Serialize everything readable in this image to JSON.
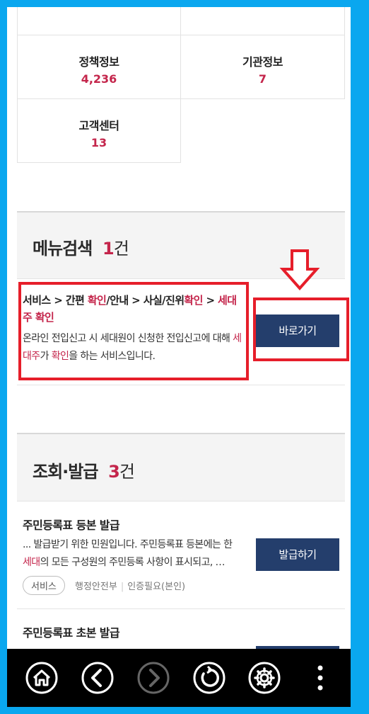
{
  "stats": {
    "policy": {
      "label": "정책정보",
      "count": "4,236"
    },
    "agency": {
      "label": "기관정보",
      "count": "7"
    },
    "center": {
      "label": "고객센터",
      "count": "13"
    }
  },
  "menu_search": {
    "title": "메뉴검색",
    "count": "1",
    "unit": "건",
    "result": {
      "path_parts": [
        "서비스 > 간편 ",
        "확인",
        "/안내 > 사실/진위",
        "확인",
        " > ",
        "세대주 확인"
      ],
      "desc_parts": [
        "온라인 전입신고 시 세대원이 신청한 전입신고에 대해 ",
        "세대주",
        "가 ",
        "확인",
        "을 하는 서비스입니다."
      ],
      "button": "바로가기"
    }
  },
  "inquiry": {
    "title": "조회·발급",
    "count": "3",
    "unit": "건",
    "items": [
      {
        "title": "주민등록표 등본 발급",
        "desc_line1": "... 발급받기 위한 민원입니다. 주민등록표 등본에는 한",
        "desc_line2_hl": "세대",
        "desc_line2_rest": "의 모든 구성원의 주민등록 사항이 표시되고, …",
        "tag": "서비스",
        "agency": "행정안전부",
        "auth": "인증필요(본인)",
        "button": "발급하기"
      },
      {
        "title": "주민등록표 초본 발급"
      }
    ]
  },
  "navbar": {
    "icons": [
      "home-icon",
      "back-icon",
      "forward-icon",
      "refresh-icon",
      "settings-icon",
      "more-icon"
    ]
  },
  "colors": {
    "accent": "#c4254b",
    "button": "#243e6c",
    "frame": "#0aa7ef",
    "annotation": "#e61e2a"
  }
}
